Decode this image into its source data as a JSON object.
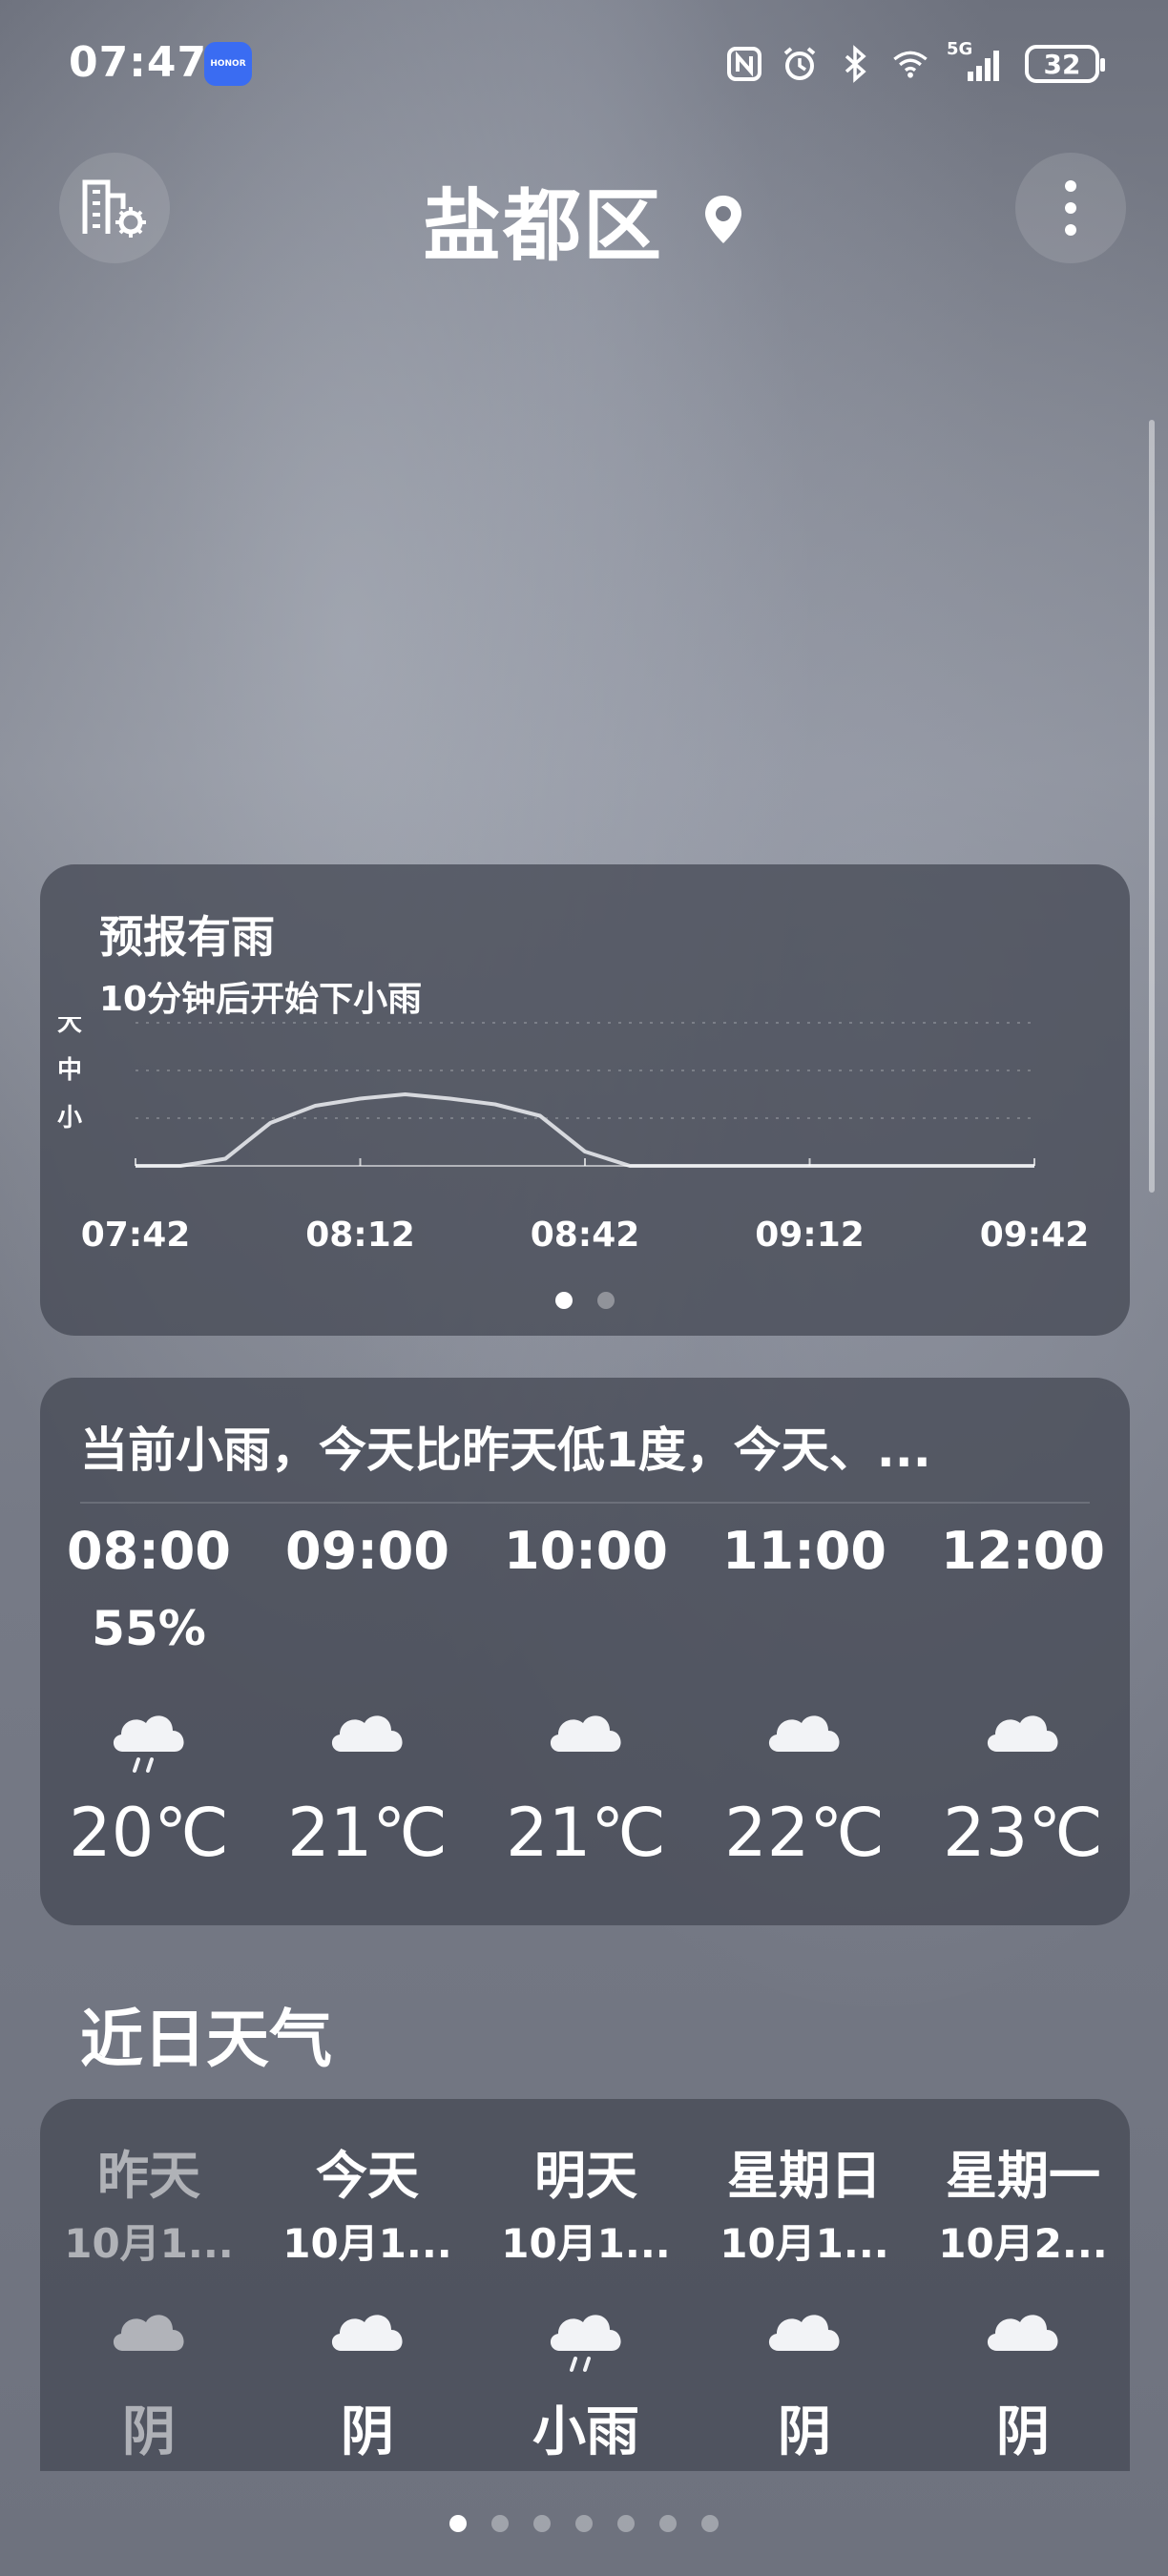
{
  "status_bar": {
    "time": "07:47",
    "brand_badge": "HONOR",
    "network": "5G",
    "battery": "32"
  },
  "header": {
    "city": "盐都区"
  },
  "rain_card": {
    "title": "预报有雨",
    "subtitle": "10分钟后开始下小雨",
    "levels": [
      "大",
      "中",
      "小"
    ],
    "times": [
      "07:42",
      "08:12",
      "08:42",
      "09:12",
      "09:42"
    ],
    "intensity": [
      0,
      0,
      0.05,
      0.3,
      0.42,
      0.47,
      0.5,
      0.47,
      0.43,
      0.35,
      0.1,
      0,
      0,
      0,
      0,
      0,
      0,
      0,
      0,
      0,
      0
    ],
    "pager_active": 0,
    "pager_count": 2
  },
  "hourly_card": {
    "summary": "当前小雨，今天比昨天低1度，今天、...",
    "hours": [
      {
        "time": "08:00",
        "precip": "55%",
        "icon": "rain-cloud-icon",
        "temp": "20℃"
      },
      {
        "time": "09:00",
        "precip": "",
        "icon": "cloud-icon",
        "temp": "21℃"
      },
      {
        "time": "10:00",
        "precip": "",
        "icon": "cloud-icon",
        "temp": "21℃"
      },
      {
        "time": "11:00",
        "precip": "",
        "icon": "cloud-icon",
        "temp": "22℃"
      },
      {
        "time": "12:00",
        "precip": "",
        "icon": "cloud-icon",
        "temp": "23℃"
      }
    ]
  },
  "daily_section": {
    "title": "近日天气",
    "days": [
      {
        "day": "昨天",
        "date": "10月1...",
        "icon": "cloud-icon",
        "condition": "阴",
        "dim": true
      },
      {
        "day": "今天",
        "date": "10月1...",
        "icon": "cloud-icon",
        "condition": "阴",
        "dim": false
      },
      {
        "day": "明天",
        "date": "10月1...",
        "icon": "rain-cloud-icon",
        "condition": "小雨",
        "dim": false
      },
      {
        "day": "星期日",
        "date": "10月1...",
        "icon": "cloud-icon",
        "condition": "阴",
        "dim": false
      },
      {
        "day": "星期一",
        "date": "10月2...",
        "icon": "cloud-icon",
        "condition": "阴",
        "dim": false
      }
    ]
  },
  "page_indicator": {
    "count": 7,
    "active": 0
  },
  "colors": {
    "card_bg": "#464a56",
    "text": "#ffffff",
    "accent_badge": "#3a6cf2"
  }
}
